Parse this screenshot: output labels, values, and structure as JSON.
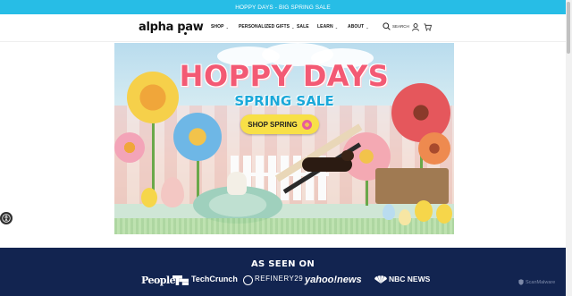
{
  "announcement": {
    "text": "HOPPY DAYS - BIG SPRING SALE"
  },
  "header": {
    "logo": "alpha paw",
    "nav": [
      {
        "label": "SHOP",
        "has_dropdown": true
      },
      {
        "label": "PERSONALIZED GIFTS",
        "has_dropdown": true
      },
      {
        "label": "SALE",
        "has_dropdown": false
      },
      {
        "label": "LEARN",
        "has_dropdown": true
      },
      {
        "label": "ABOUT",
        "has_dropdown": true
      }
    ],
    "search_label": "SEARCH",
    "icons": [
      "search-icon",
      "user-icon",
      "cart-icon"
    ]
  },
  "hero": {
    "title": "HOPPY DAYS",
    "subtitle": "SPRING SALE",
    "cta_label": "SHOP SPRING"
  },
  "as_seen_on": {
    "title": "AS SEEN ON",
    "logos": [
      "People",
      "TechCrunch",
      "REFINERY29",
      "yahoo!news",
      "NBC NEWS"
    ]
  },
  "watermark": {
    "text": "ScanMalware"
  },
  "colors": {
    "announcement_bg": "#27bde6",
    "press_bg": "#122450",
    "hero_title": "#f35a74",
    "hero_subtitle": "#1aa8d9",
    "cta_bg": "#f8e047"
  }
}
